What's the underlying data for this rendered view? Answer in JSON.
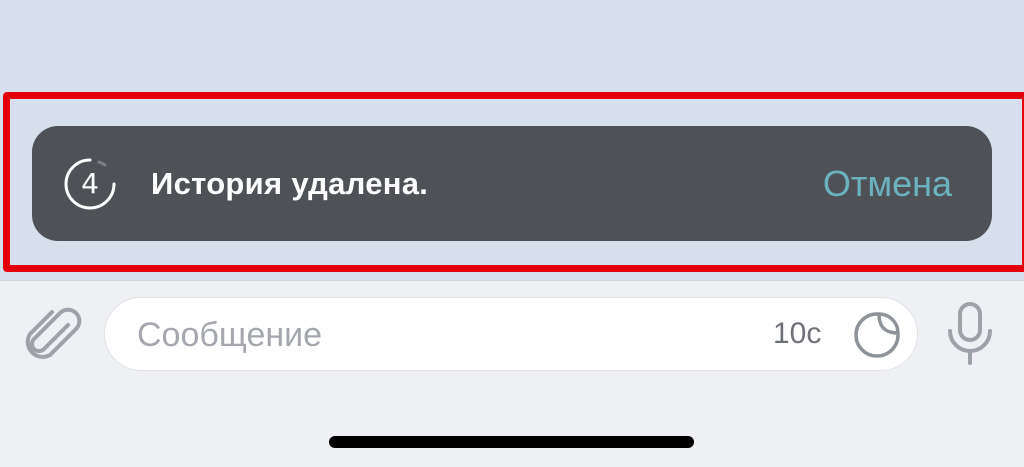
{
  "toast": {
    "countdown": "4",
    "message": "История удалена.",
    "undo_label": "Отмена"
  },
  "composer": {
    "placeholder": "Сообщение",
    "self_destruct_timer": "10с"
  },
  "icons": {
    "attach": "paperclip-icon",
    "sticker": "sticker-icon",
    "mic": "microphone-icon",
    "countdown": "countdown-timer-icon"
  },
  "colors": {
    "chat_background": "#d6e0ec",
    "toast_background": "#4e5257",
    "undo_accent": "#6cb3bf",
    "highlight_border": "#e3000b",
    "input_bar_background": "#eff0f3"
  }
}
